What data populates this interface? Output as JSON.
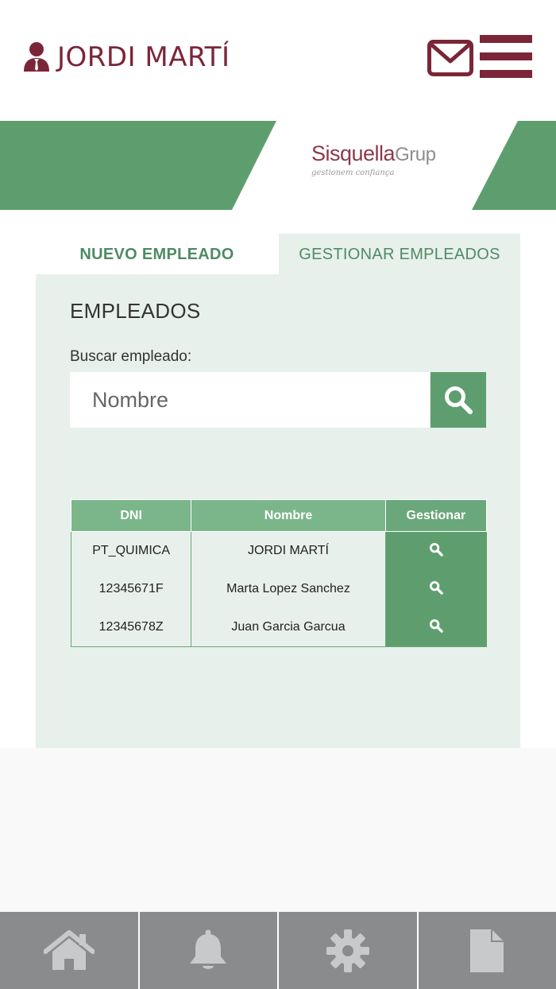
{
  "header": {
    "user_name": "JORDI MARTÍ",
    "icons": [
      "user-icon",
      "mail-icon",
      "menu-icon"
    ]
  },
  "brand": {
    "logo_main": "Sisquella",
    "logo_suffix": "Grup",
    "tagline": "gestionem confiança"
  },
  "tabs": [
    {
      "label": "NUEVO EMPLEADO",
      "active": false
    },
    {
      "label": "GESTIONAR EMPLEADOS",
      "active": true
    }
  ],
  "section": {
    "title": "EMPLEADOS",
    "search_label": "Buscar empleado:",
    "search_placeholder": "Nombre"
  },
  "table": {
    "headers": [
      "DNI",
      "Nombre",
      "Gestionar"
    ],
    "rows": [
      {
        "dni": "PT_QUIMICA",
        "name": "JORDI MARTÍ"
      },
      {
        "dni": "12345671F",
        "name": "Marta Lopez Sanchez"
      },
      {
        "dni": "12345678Z",
        "name": "Juan Garcia Garcua"
      }
    ]
  },
  "bottom_nav": [
    "home-icon",
    "bell-icon",
    "gear-icon",
    "document-icon"
  ],
  "colors": {
    "brand_red": "#7b2638",
    "green": "#5e9e6e",
    "green_header": "#7bb68b",
    "panel_bg": "#e8f0eb",
    "nav_gray": "#8a8b8d"
  }
}
